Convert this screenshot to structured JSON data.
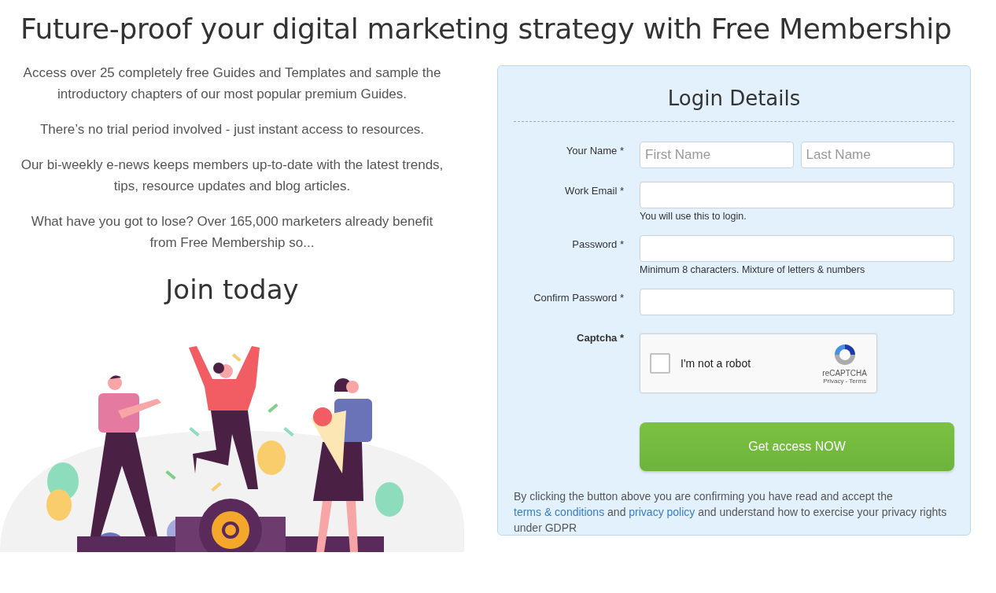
{
  "heading": "Future-proof your digital marketing strategy with Free Membership",
  "intro": [
    "Access over 25 completely free Guides and Templates and sample the introductory chapters of our most popular premium Guides.",
    "There’s no trial period involved - just instant access to resources.",
    "Our bi-weekly e-news keeps members up-to-date with the latest trends, tips, resource updates and blog articles.",
    "What have you got to lose? Over 165,000 marketers already benefit from Free Membership so..."
  ],
  "join_heading": "Join today",
  "login": {
    "title": "Login Details",
    "fields": [
      {
        "kind": "name",
        "label": "Your Name *",
        "inputs": [
          {
            "placeholder": "First Name"
          },
          {
            "placeholder": "Last Name"
          }
        ]
      },
      {
        "kind": "text",
        "label": "Work Email *",
        "hint": "You will use this to login."
      },
      {
        "kind": "text",
        "label": "Password *",
        "hint": "Minimum 8 characters. Mixture of letters & numbers"
      },
      {
        "kind": "text",
        "label": "Confirm Password *"
      },
      {
        "kind": "captcha",
        "label": "Captcha *",
        "checkbox_label": "I'm not a robot",
        "checked": false,
        "brand": "reCAPTCHA",
        "links": "Privacy - Terms"
      }
    ],
    "submit": "Get access NOW",
    "consent": [
      {
        "kind": "text",
        "text": "By clicking the button above you are confirming you have read and accept the "
      },
      {
        "kind": "link",
        "text": "terms & conditions"
      },
      {
        "kind": "text",
        "text": " and "
      },
      {
        "kind": "link",
        "text": "privacy policy"
      },
      {
        "kind": "text",
        "text": " and understand how to exercise your privacy rights under GDPR"
      }
    ]
  }
}
